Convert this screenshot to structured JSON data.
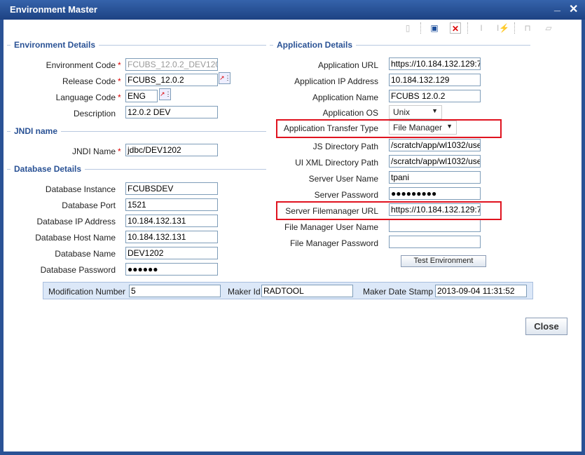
{
  "window": {
    "title": "Environment Master",
    "minimize": "_",
    "close": "✕"
  },
  "toolbar": [
    "new-icon",
    "save-icon",
    "delete-icon",
    "copy-icon",
    "unlock-rename-icon",
    "unlock-icon",
    "open-icon"
  ],
  "env": {
    "header": "Environment Details",
    "code_label": "Environment Code",
    "code": "FCUBS_12.0.2_DEV120",
    "release_label": "Release Code",
    "release": "FCUBS_12.0.2",
    "lang_label": "Language Code",
    "lang": "ENG",
    "desc_label": "Description",
    "desc": "12.0.2 DEV"
  },
  "jndi": {
    "header": "JNDI name",
    "label": "JNDI Name",
    "value": "jdbc/DEV1202"
  },
  "db": {
    "header": "Database Details",
    "rows": [
      {
        "label": "Database Instance",
        "value": "FCUBSDEV"
      },
      {
        "label": "Database Port",
        "value": "1521"
      },
      {
        "label": "Database IP Address",
        "value": "10.184.132.131"
      },
      {
        "label": "Database Host Name",
        "value": "10.184.132.131"
      },
      {
        "label": "Database Name",
        "value": "DEV1202"
      },
      {
        "label": "Database Password",
        "value": "●●●●●●"
      }
    ]
  },
  "app": {
    "header": "Application Details",
    "url_label": "Application URL",
    "url": "https://10.184.132.129:7",
    "ip_label": "Application IP Address",
    "ip": "10.184.132.129",
    "name_label": "Application Name",
    "name": "FCUBS 12.0.2",
    "os_label": "Application OS",
    "os": "Unix",
    "transfer_label": "Application Transfer Type",
    "transfer": "File Manager",
    "js_label": "JS Directory Path",
    "js": "/scratch/app/wl1032/use",
    "uixml_label": "UI XML Directory Path",
    "uixml": "/scratch/app/wl1032/use",
    "user_label": "Server User Name",
    "user": "tpani",
    "pwd_label": "Server Password",
    "pwd": "●●●●●●●●●",
    "fm_url_label": "Server Filemanager URL",
    "fm_url": "https://10.184.132.129:7",
    "fm_user_label": "File Manager User Name",
    "fm_user": "",
    "fm_pwd_label": "File Manager Password",
    "fm_pwd": "",
    "test_button": "Test Environment"
  },
  "footer": {
    "mod_label": "Modification Number",
    "mod": "5",
    "maker_label": "Maker Id",
    "maker": "RADTOOL",
    "stamp_label": "Maker Date Stamp",
    "stamp": "2013-09-04 11:31:52"
  },
  "close_button": "Close",
  "required_mark": "*"
}
